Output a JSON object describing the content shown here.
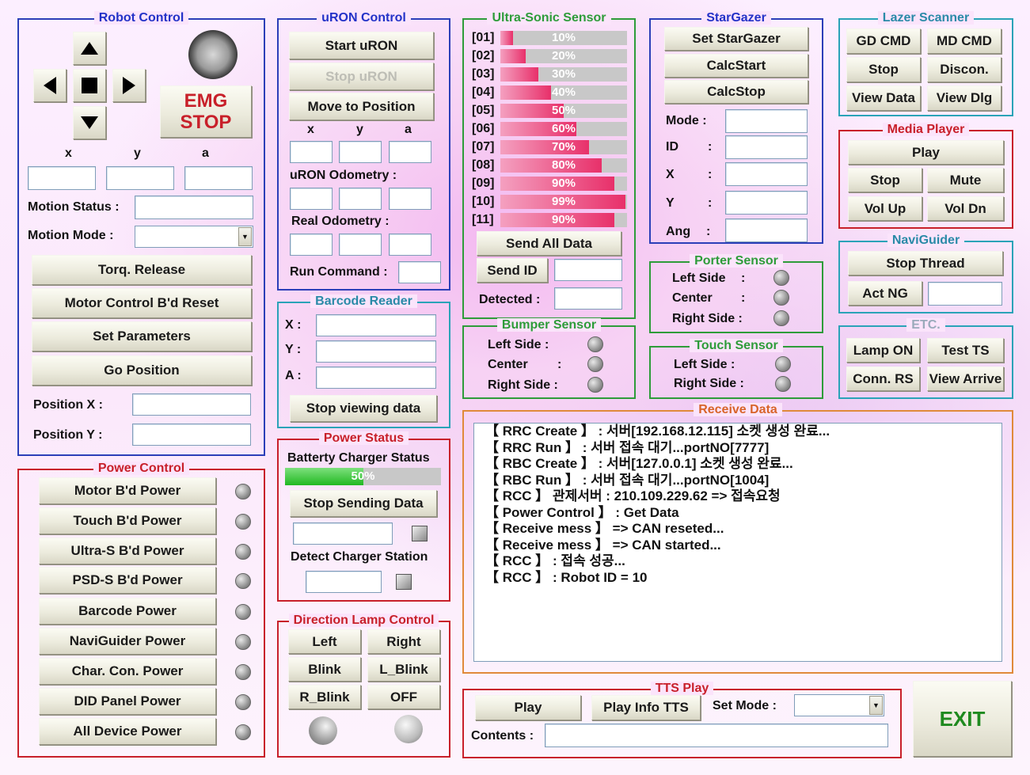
{
  "robot_control": {
    "title": "Robot Control",
    "emg_line1": "EMG",
    "emg_line2": "STOP",
    "x_label": "x",
    "y_label": "y",
    "a_label": "a",
    "motion_status_label": "Motion Status :",
    "motion_mode_label": "Motion Mode  :",
    "torq_release": "Torq. Release",
    "motor_reset": "Motor Control B'd Reset",
    "set_parameters": "Set Parameters",
    "go_position": "Go Position",
    "position_x_label": "Position X   :",
    "position_y_label": "Position Y   :"
  },
  "uron_control": {
    "title": "uRON Control",
    "start": "Start uRON",
    "stop": "Stop uRON",
    "move": "Move to Position",
    "x_label": "x",
    "y_label": "y",
    "a_label": "a",
    "odometry_label": "uRON Odometry :",
    "real_odometry_label": "Real Odometry :",
    "run_command_label": "Run Command :"
  },
  "ultrasonic": {
    "title": "Ultra-Sonic Sensor",
    "sensors": [
      {
        "id": "[01]",
        "value": 10,
        "text": "10%"
      },
      {
        "id": "[02]",
        "value": 20,
        "text": "20%"
      },
      {
        "id": "[03]",
        "value": 30,
        "text": "30%"
      },
      {
        "id": "[04]",
        "value": 40,
        "text": "40%"
      },
      {
        "id": "[05]",
        "value": 50,
        "text": "50%"
      },
      {
        "id": "[06]",
        "value": 60,
        "text": "60%"
      },
      {
        "id": "[07]",
        "value": 70,
        "text": "70%"
      },
      {
        "id": "[08]",
        "value": 80,
        "text": "80%"
      },
      {
        "id": "[09]",
        "value": 90,
        "text": "90%"
      },
      {
        "id": "[10]",
        "value": 99,
        "text": "99%"
      },
      {
        "id": "[11]",
        "value": 90,
        "text": "90%"
      }
    ],
    "send_all": "Send All Data",
    "send_id": "Send ID",
    "detected_label": "Detected :"
  },
  "stargazer": {
    "title": "StarGazer",
    "set": "Set StarGazer",
    "calc_start": "CalcStart",
    "calc_stop": "CalcStop",
    "mode_label": "Mode  :",
    "id_label": "ID",
    "x_label": "X",
    "y_label": "Y",
    "ang_label": "Ang",
    "colon": ":"
  },
  "lazer": {
    "title": "Lazer Scanner",
    "gd_cmd": "GD CMD",
    "md_cmd": "MD CMD",
    "stop": "Stop",
    "discon": "Discon.",
    "view_data": "View Data",
    "view_dlg": "View Dlg"
  },
  "media": {
    "title": "Media Player",
    "play": "Play",
    "stop": "Stop",
    "mute": "Mute",
    "vol_up": "Vol Up",
    "vol_dn": "Vol Dn"
  },
  "naviguider": {
    "title": "NaviGuider",
    "stop_thread": "Stop Thread",
    "act_ng": "Act NG"
  },
  "etc": {
    "title": "ETC.",
    "lamp_on": "Lamp ON",
    "test_ts": "Test TS",
    "conn_rs": "Conn. RS",
    "view_arrive": "View Arrive"
  },
  "porter": {
    "title": "Porter Sensor",
    "left": "Left Side",
    "center": "Center",
    "right": "Right Side :",
    "colon": ":"
  },
  "bumper": {
    "title": "Bumper Sensor",
    "left": "Left  Side  :",
    "center": "Center",
    "right": "Right Side :",
    "colon": ":"
  },
  "touch": {
    "title": "Touch Sensor",
    "left": "Left Side   :",
    "right": "Right Side :"
  },
  "barcode": {
    "title": "Barcode Reader",
    "x_label": "X :",
    "y_label": "Y :",
    "a_label": "A :",
    "stop": "Stop viewing data"
  },
  "power_status": {
    "title": "Power Status",
    "battery_label": "Batterty Charger Status",
    "battery_value": 50,
    "battery_text": "50%",
    "stop_sending": "Stop Sending Data",
    "detect_label": "Detect Charger Station"
  },
  "power_control": {
    "title": "Power Control",
    "items": [
      "Motor B'd Power",
      "Touch B'd Power",
      "Ultra-S B'd Power",
      "PSD-S B'd Power",
      "Barcode Power",
      "NaviGuider Power",
      "Char. Con. Power",
      "DID Panel Power",
      "All Device Power"
    ]
  },
  "direction_lamp": {
    "title": "Direction Lamp Control",
    "left": "Left",
    "right": "Right",
    "blink": "Blink",
    "l_blink": "L_Blink",
    "r_blink": "R_Blink",
    "off": "OFF"
  },
  "receive": {
    "title": "Receive Data",
    "lines": [
      "【 RRC Create 】 : 서버[192.168.12.115] 소켓 생성 완료...",
      "【 RRC Run 】 : 서버 접속 대기...portNO[7777]",
      "【 RBC Create 】 : 서버[127.0.0.1] 소켓 생성 완료...",
      "【 RBC Run  】 : 서버 접속 대기...portNO[1004]",
      "【 RCC 】 관제서버 : 210.109.229.62 => 접속요청",
      "【 Power Control 】 : Get Data",
      "【 Receive mess 】 => CAN reseted...",
      "【 Receive mess 】 => CAN started...",
      "【 RCC 】 : 접속 성공...",
      "【 RCC 】 : Robot ID = 10"
    ]
  },
  "tts": {
    "title": "TTS Play",
    "play": "Play",
    "play_info": "Play Info TTS",
    "set_mode_label": "Set Mode :",
    "contents_label": "Contents :"
  },
  "exit": "EXIT",
  "colors": {
    "group_blue": "#2b3fb8",
    "group_red": "#c8202a",
    "group_green": "#2e9c3a",
    "exit_green": "#1f8a1f",
    "emg_red": "#c8202a"
  }
}
